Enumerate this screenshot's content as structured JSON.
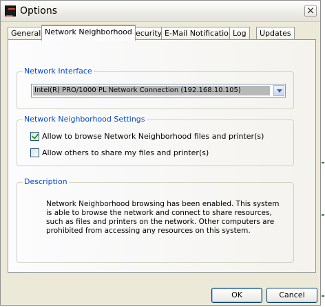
{
  "window": {
    "title": "Options",
    "close_glyph": "×",
    "icon": "app-logo-icon"
  },
  "tabs": [
    {
      "label": "General",
      "active": false
    },
    {
      "label": "Network Neighborhood",
      "active": true
    },
    {
      "label": "Security",
      "active": false
    },
    {
      "label": "E-Mail Notification",
      "active": false
    },
    {
      "label": "Log",
      "active": false
    },
    {
      "label": "Updates",
      "active": false
    }
  ],
  "network_interface": {
    "legend": "Network Interface",
    "selected_value": "Intel(R) PRO/1000 PL Network Connection (192.168.10.105)"
  },
  "neighborhood_settings": {
    "legend": "Network Neighborhood Settings",
    "options": [
      {
        "label": "Allow to browse Network Neighborhood files and printer(s)",
        "checked": true
      },
      {
        "label": "Allow others to share my files and printer(s)",
        "checked": false
      }
    ]
  },
  "description": {
    "legend": "Description",
    "text": "Network Neighborhood browsing has been enabled.  This system is able to browse the network and connect to share resources, such as files and printers on the network. Other computers are prohibited from accessing any resources on this system."
  },
  "buttons": {
    "ok": "OK",
    "cancel": "Cancel"
  },
  "colors": {
    "legend_text": "#0046d5",
    "active_tab_accent": "#e68b2c",
    "checkmark": "#21a121"
  }
}
